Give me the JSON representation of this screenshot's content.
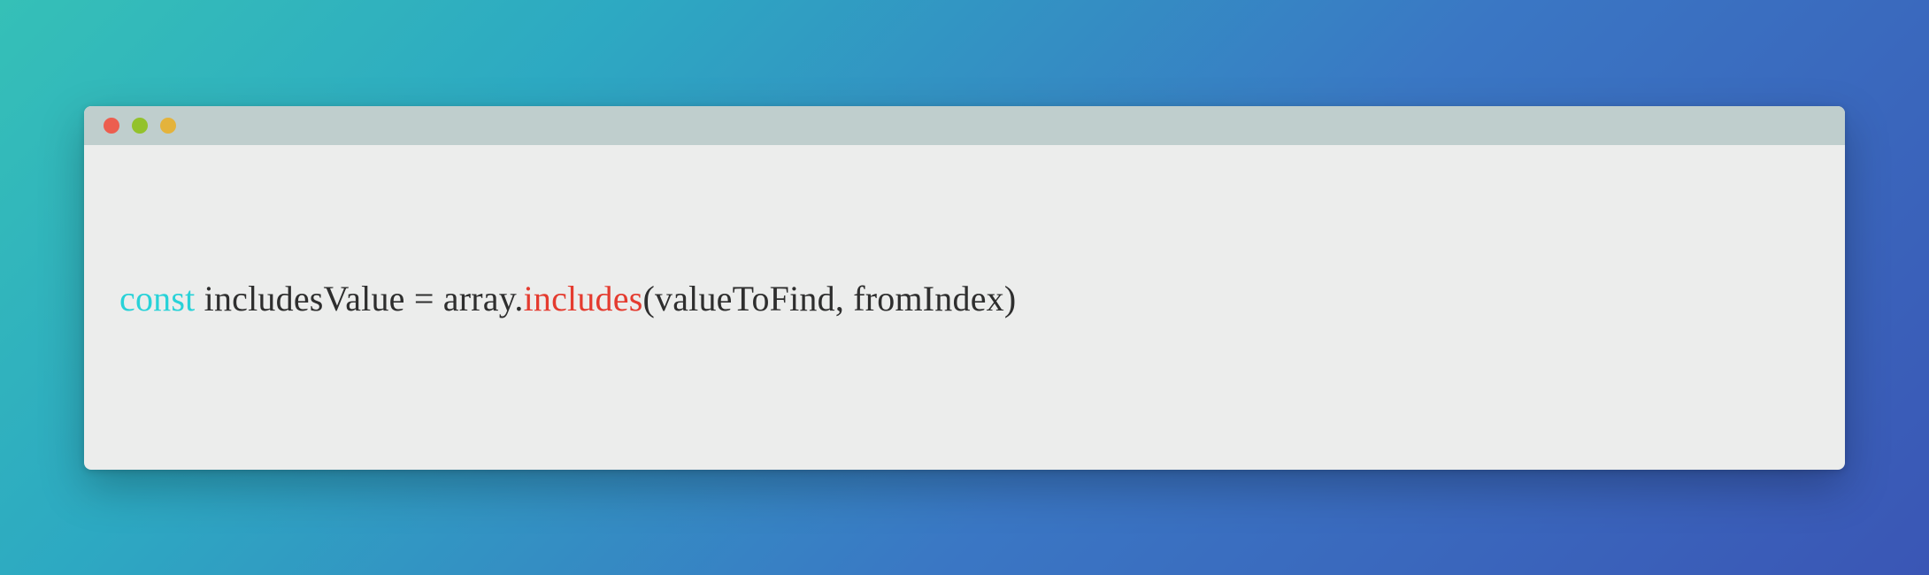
{
  "traffic_lights": {
    "close": "#ec5e4f",
    "minimize": "#93c22c",
    "zoom": "#e4b33c"
  },
  "code": {
    "tokens": {
      "keyword": "const",
      "space1": " ",
      "varname": "includesValue",
      "assign": " = ",
      "object": "array",
      "dot": ".",
      "method": "includes",
      "lparen": "(",
      "arg1": "valueToFind",
      "comma": ", ",
      "arg2": "fromIndex",
      "rparen": ")"
    }
  }
}
